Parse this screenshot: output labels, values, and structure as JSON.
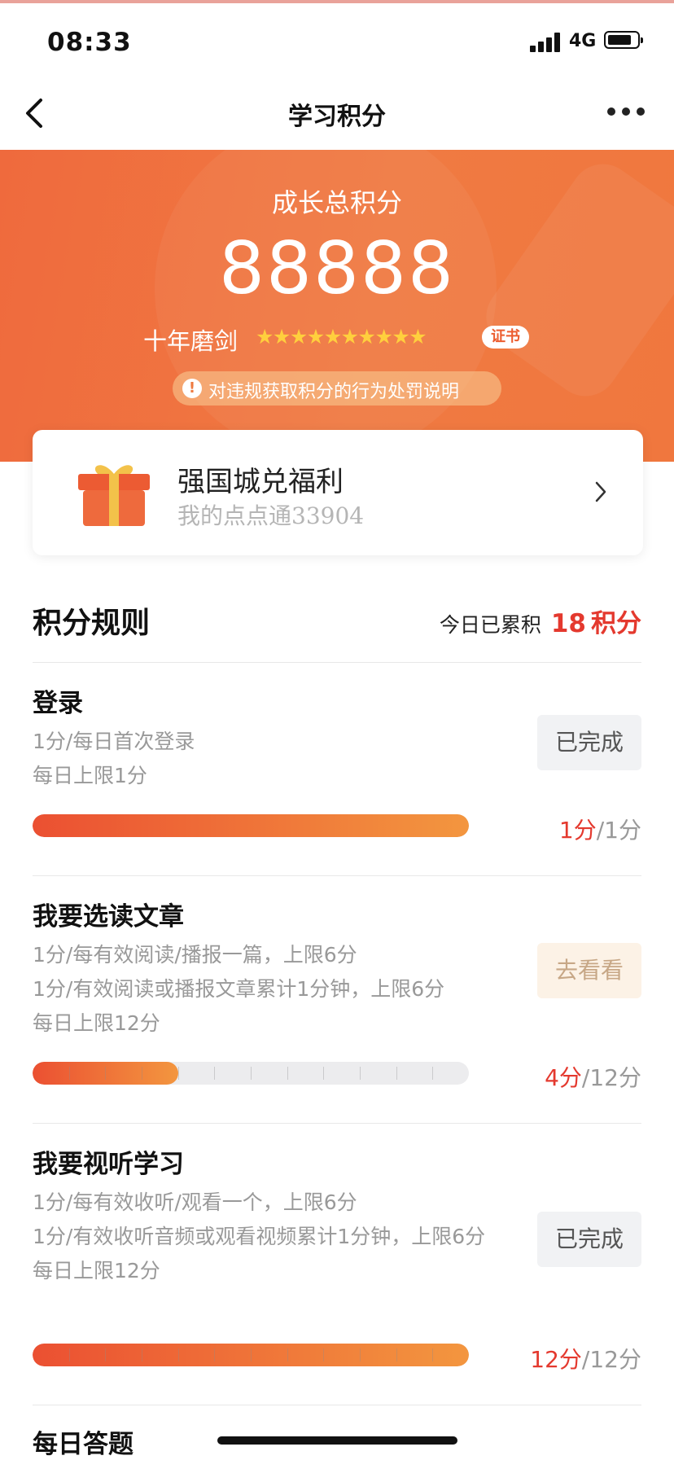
{
  "status_bar": {
    "time": "08:33",
    "network": "4G"
  },
  "nav": {
    "title": "学习积分"
  },
  "hero": {
    "label": "成长总积分",
    "total_score": "88888",
    "rank_title": "十年磨剑",
    "star_count": 10,
    "cert_label": "证书",
    "notice_text": "对违规获取积分的行为处罚说明",
    "colors": {
      "start": "#ef6a3d",
      "end": "#f0773e"
    }
  },
  "welfare_card": {
    "title": "强国城兑福利",
    "subtitle": "我的点点通33904"
  },
  "rules": {
    "title": "积分规则",
    "today_label": "今日已累积",
    "today_score": "18",
    "today_unit": "积分",
    "items": [
      {
        "name": "登录",
        "desc": [
          "1分/每日首次登录",
          "每日上限1分"
        ],
        "button": "已完成",
        "button_state": "done",
        "earned": "1分",
        "limit": "/1分",
        "progress": 1.0,
        "segments": 1
      },
      {
        "name": "我要选读文章",
        "desc": [
          "1分/每有效阅读/播报一篇，上限6分",
          "1分/有效阅读或播报文章累计1分钟，上限6分",
          "每日上限12分"
        ],
        "button": "去看看",
        "button_state": "todo",
        "earned": "4分",
        "limit": "/12分",
        "progress": 0.3333,
        "segments": 12
      },
      {
        "name": "我要视听学习",
        "desc": [
          "1分/每有效收听/观看一个，上限6分",
          "1分/有效收听音频或观看视频累计1分钟，上限6分",
          "每日上限12分"
        ],
        "button": "已完成",
        "button_state": "done",
        "earned": "12分",
        "limit": "/12分",
        "progress": 1.0,
        "segments": 12
      },
      {
        "name": "每日答题"
      }
    ]
  }
}
